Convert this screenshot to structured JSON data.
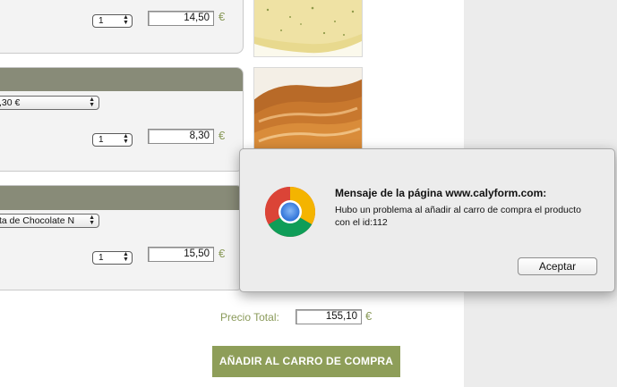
{
  "products": [
    {
      "quantity": "1",
      "price": "14,50",
      "currency": "€",
      "image": "omelette-photo"
    },
    {
      "variant_label": ",30 €",
      "quantity": "1",
      "price": "8,30",
      "currency": "€",
      "image": "toast-photo"
    },
    {
      "variant_label": "ta de Chocolate N",
      "quantity": "1",
      "price": "15,50",
      "currency": "€"
    }
  ],
  "total": {
    "label": "Precio Total:",
    "value": "155,10",
    "currency": "€"
  },
  "add_button_label": "AÑADIR AL CARRO DE COMPRA",
  "dialog": {
    "title": "Mensaje de la página www.calyform.com:",
    "message": "Hubo un problema al añadir al carro de compra el producto con el id:112",
    "ok_label": "Aceptar",
    "icon": "chrome-icon"
  },
  "colors": {
    "accent_green": "#8e9e59",
    "header_gray": "#888b78"
  }
}
